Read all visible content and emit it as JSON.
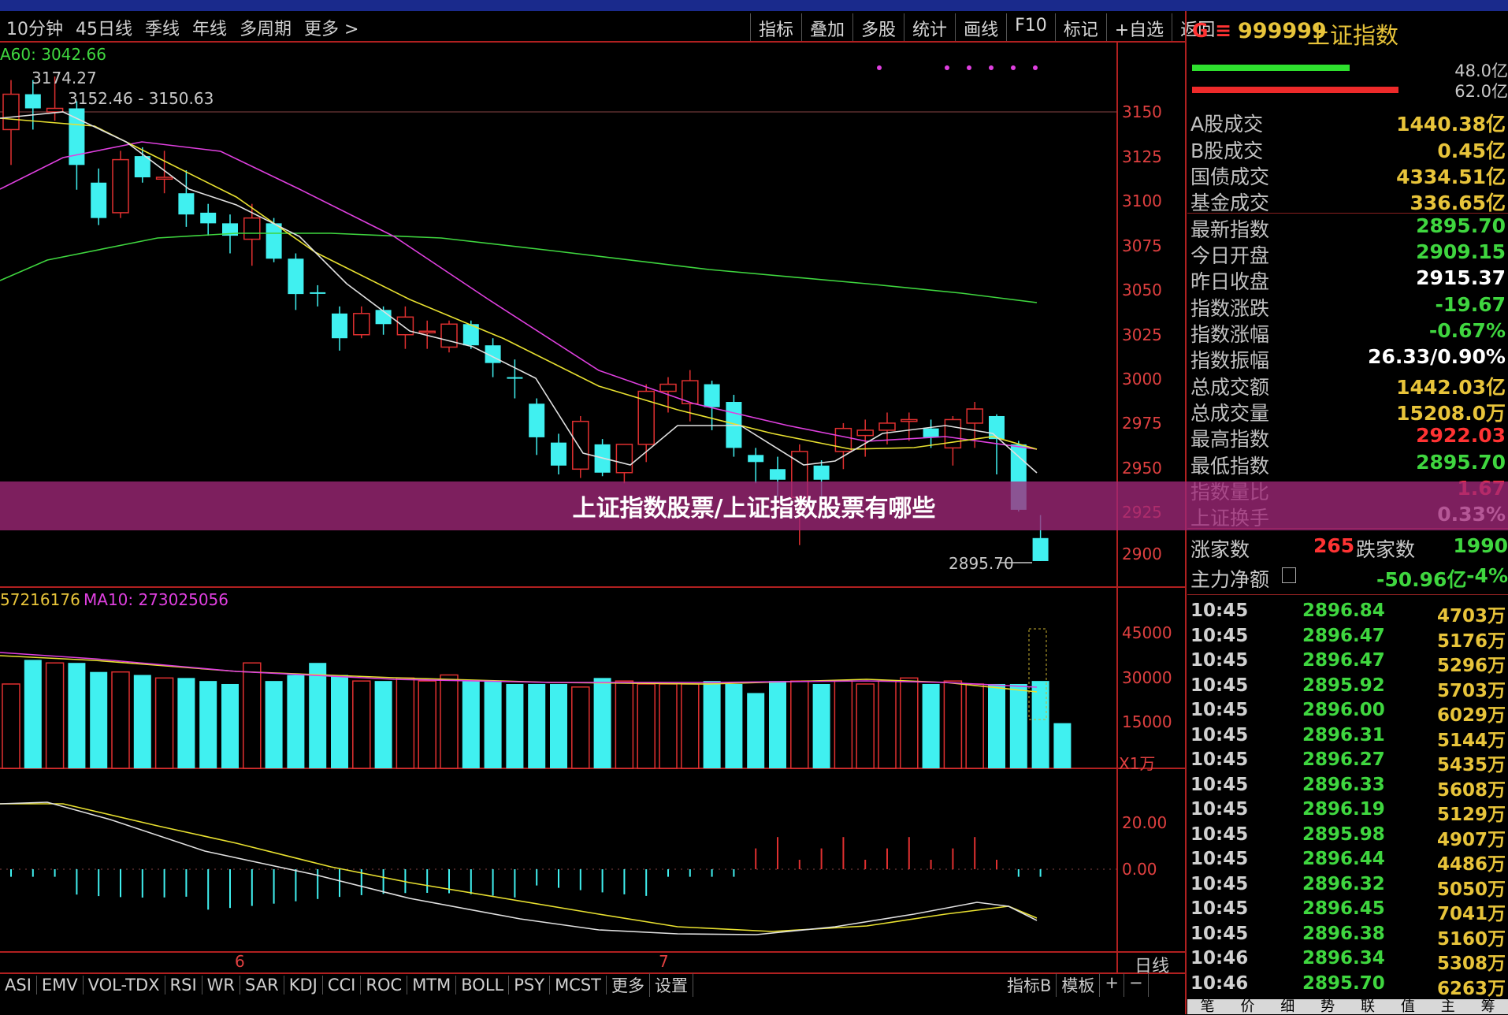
{
  "tabs": [
    "10分钟",
    "45日线",
    "季线",
    "年线",
    "多周期",
    "更多 >"
  ],
  "tools": [
    "指标",
    "叠加",
    "多股",
    "统计",
    "画线",
    "F10",
    "标记",
    "+自选",
    "返回"
  ],
  "ma_labels": {
    "ma60": "A60: 3042.66",
    "hi": "3174.27",
    "range": "3152.46 - 3150.63",
    "last": "2895.70"
  },
  "vol_labels": {
    "vol": "57216176",
    "ma10": "MA10: 273025056",
    "unit": "X1万"
  },
  "price_axis": [
    "3150",
    "3125",
    "3100",
    "3075",
    "3050",
    "3025",
    "3000",
    "2975",
    "2950",
    "2925",
    "2900"
  ],
  "vol_axis": [
    "45000",
    "30000",
    "15000"
  ],
  "macd_axis": [
    "20.00",
    "0.00"
  ],
  "date_labels": [
    "6",
    "7"
  ],
  "period": "日线",
  "banner": "上证指数股票/上证指数股票有哪些",
  "quote": {
    "header_code": "999999",
    "header_name": "上证指数",
    "header_prefix": "G ≡",
    "bar1_val": "48.0亿",
    "bar2_val": "62.0亿",
    "rows": [
      {
        "label": "A股成交",
        "value": "1440.38亿",
        "color": "#e8c43a"
      },
      {
        "label": "B股成交",
        "value": "0.45亿",
        "color": "#e8c43a"
      },
      {
        "label": "国债成交",
        "value": "4334.51亿",
        "color": "#e8c43a"
      },
      {
        "label": "基金成交",
        "value": "336.65亿",
        "color": "#e8c43a"
      },
      {
        "label": "最新指数",
        "value": "2895.70",
        "color": "#3fd63f"
      },
      {
        "label": "今日开盘",
        "value": "2909.15",
        "color": "#3fd63f"
      },
      {
        "label": "昨日收盘",
        "value": "2915.37",
        "color": "#ffffff"
      },
      {
        "label": "指数涨跌",
        "value": "-19.67",
        "color": "#3fd63f"
      },
      {
        "label": "指数涨幅",
        "value": "-0.67%",
        "color": "#3fd63f"
      },
      {
        "label": "指数振幅",
        "value": "26.33/0.90%",
        "color": "#ffffff"
      },
      {
        "label": "总成交额",
        "value": "1442.03亿",
        "color": "#e8c43a"
      },
      {
        "label": "总成交量",
        "value": "15208.0万",
        "color": "#e8c43a"
      },
      {
        "label": "最高指数",
        "value": "2922.03",
        "color": "#ff3333"
      },
      {
        "label": "最低指数",
        "value": "2895.70",
        "color": "#3fd63f"
      },
      {
        "label": "指数量比",
        "value": "1.67",
        "color": "#ff3333"
      },
      {
        "label": "上证换手",
        "value": "0.33%",
        "color": "#ffffff"
      }
    ],
    "adv_label": "涨家数",
    "adv_val": "265",
    "dec_label": "跌家数",
    "dec_val": "1990",
    "flow_label": "主力净额",
    "flow_val": "-50.96亿",
    "flow_pct": "-4%",
    "ticks": [
      {
        "t": "10:45",
        "p": "2896.84",
        "v": "4703万"
      },
      {
        "t": "10:45",
        "p": "2896.47",
        "v": "5176万"
      },
      {
        "t": "10:45",
        "p": "2896.47",
        "v": "5296万"
      },
      {
        "t": "10:45",
        "p": "2895.92",
        "v": "5703万"
      },
      {
        "t": "10:45",
        "p": "2896.00",
        "v": "6029万"
      },
      {
        "t": "10:45",
        "p": "2896.31",
        "v": "5144万"
      },
      {
        "t": "10:45",
        "p": "2896.27",
        "v": "5435万"
      },
      {
        "t": "10:45",
        "p": "2896.33",
        "v": "5608万"
      },
      {
        "t": "10:45",
        "p": "2896.19",
        "v": "5129万"
      },
      {
        "t": "10:45",
        "p": "2895.98",
        "v": "4907万"
      },
      {
        "t": "10:45",
        "p": "2896.44",
        "v": "4486万"
      },
      {
        "t": "10:45",
        "p": "2896.32",
        "v": "5050万"
      },
      {
        "t": "10:45",
        "p": "2896.45",
        "v": "7041万"
      },
      {
        "t": "10:45",
        "p": "2896.38",
        "v": "5160万"
      },
      {
        "t": "10:46",
        "p": "2896.34",
        "v": "5308万"
      },
      {
        "t": "10:46",
        "p": "2895.70",
        "v": "6263万"
      }
    ],
    "footer": [
      "笔",
      "价",
      "细",
      "势",
      "联",
      "值",
      "主",
      "筹"
    ]
  },
  "indicators": [
    "ASI",
    "EMV",
    "VOL-TDX",
    "RSI",
    "WR",
    "SAR",
    "KDJ",
    "CCI",
    "ROC",
    "MTM",
    "BOLL",
    "PSY",
    "MCST",
    "更多",
    "设置"
  ],
  "right_tools": [
    "指标B",
    "模板",
    "+",
    "−"
  ]
}
